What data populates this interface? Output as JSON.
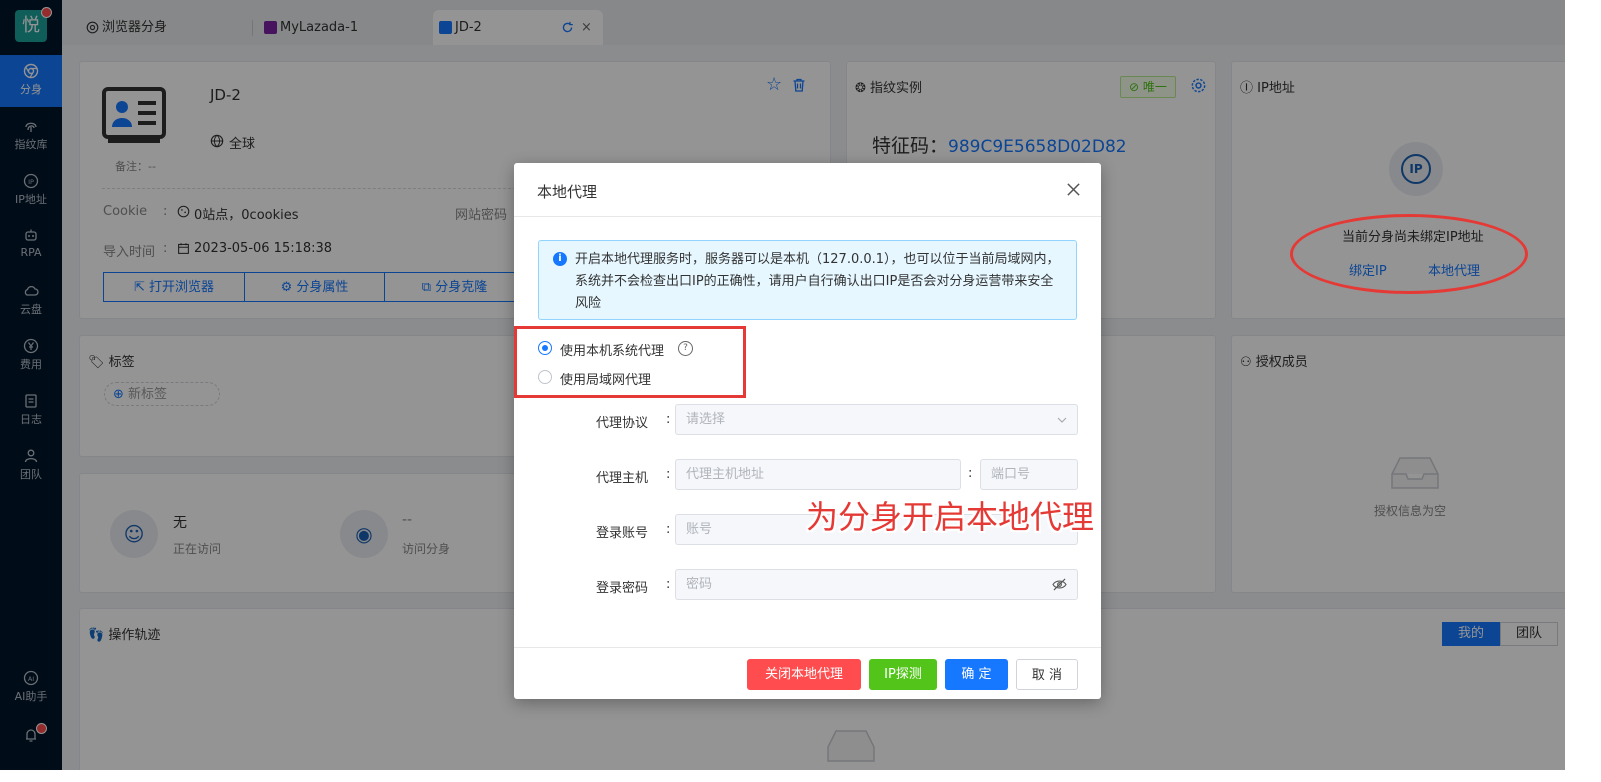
{
  "app": {
    "logo_text": "悦"
  },
  "sidebar": {
    "items": [
      {
        "label": "分身",
        "icon": "chrome-icon"
      },
      {
        "label": "指纹库",
        "icon": "fingerprint-icon"
      },
      {
        "label": "IP地址",
        "icon": "ip-icon"
      },
      {
        "label": "RPA",
        "icon": "robot-icon"
      },
      {
        "label": "云盘",
        "icon": "cloud-drive-icon"
      },
      {
        "label": "费用",
        "icon": "yen-icon"
      },
      {
        "label": "日志",
        "icon": "log-icon"
      },
      {
        "label": "团队",
        "icon": "team-icon"
      }
    ],
    "ai_label": "AI助手",
    "ai_badge": "AI"
  },
  "tabs": [
    {
      "label": "浏览器分身"
    },
    {
      "label": "MyLazada-1"
    },
    {
      "label": "JD-2"
    }
  ],
  "profile": {
    "name": "JD-2",
    "region": "全球",
    "note_label": "备注：",
    "note_value": "--",
    "cookie_label": "Cookie",
    "cookie_value": "0站点，0cookies",
    "site_pwd_label": "网站密码",
    "import_label": "导入时间",
    "import_value": "2023-05-06 15:18:38",
    "btn_open": "打开浏览器",
    "btn_props": "分身属性",
    "btn_clone": "分身克隆"
  },
  "fingerprint": {
    "title": "指纹实例",
    "badge": "唯一",
    "code_label": "特征码：",
    "code_value": "989C9E5658D02D82"
  },
  "ip_card": {
    "title": "IP地址",
    "badge": "IP",
    "empty_text": "当前分身尚未绑定IP地址",
    "bind_link": "绑定IP",
    "local_proxy_link": "本地代理"
  },
  "tags_card": {
    "title": "标签",
    "new_tag": "新标签"
  },
  "visit_card": {
    "current_value": "无",
    "current_label": "正在访问",
    "visit_value": "--",
    "visit_label": "访问分身"
  },
  "auth_card": {
    "title": "授权成员",
    "empty": "授权信息为空"
  },
  "ops_card": {
    "title": "操作轨迹",
    "tab_mine": "我的",
    "tab_team": "团队"
  },
  "modal": {
    "title": "本地代理",
    "alert": "开启本地代理服务时，服务器可以是本机（127.0.0.1），也可以位于当前局域网内，系统并不会检查出口IP的正确性，请用户自行确认出口IP是否会对分身运营带来安全风险",
    "radio_system": "使用本机系统代理",
    "radio_lan": "使用局域网代理",
    "protocol_label": "代理协议",
    "protocol_placeholder": "请选择",
    "host_label": "代理主机",
    "host_placeholder": "代理主机地址",
    "port_placeholder": "端口号",
    "account_label": "登录账号",
    "account_placeholder": "账号",
    "password_label": "登录密码",
    "password_placeholder": "密码",
    "btn_close_proxy": "关闭本地代理",
    "btn_ip_detect": "IP探测",
    "btn_ok": "确 定",
    "btn_cancel": "取 消"
  },
  "annotation": {
    "text": "为分身开启本地代理"
  },
  "colors": {
    "primary": "#1677ff",
    "danger": "#ff4d4f",
    "success": "#52c41a",
    "sidebar": "#001529",
    "annotation": "#e53935"
  }
}
